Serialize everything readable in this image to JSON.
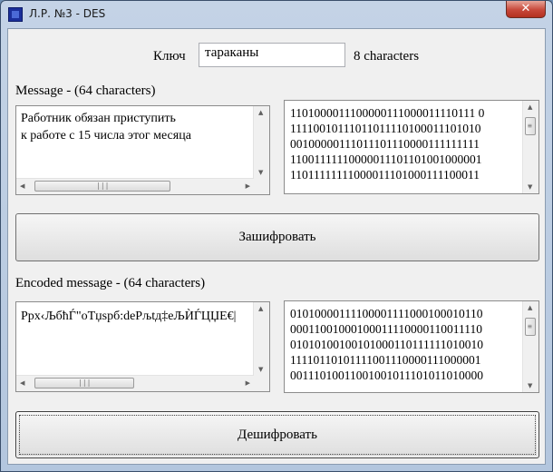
{
  "window": {
    "title": "Л.Р. №3 - DES",
    "close_glyph": "✕"
  },
  "key": {
    "label": "Ключ",
    "value": "тараканы",
    "count": "8 characters"
  },
  "message": {
    "label": "Message - (64 characters)",
    "text": "Работник обязан приступить\nк работе с 15 числа этог месяца",
    "binary": "1101000011100000111000011110111 0\n11110010111011011110100011101010\n00100000111011101110000111111111\n11001111110000011101101001000001\n11011111111000011101000111100011"
  },
  "encrypt_button": {
    "label": "Зашифровать"
  },
  "encoded": {
    "label": "Encoded message - (64 characters)",
    "text": "Ppx‹ЉбћЃ\"оТџѕрб:deРљtд‡еЉЍЃЦЏЕ€|",
    "binary": "01010000111100001111000100010110\n00011001000100011110000110011110\n01010100100101000110111111010010\n11110110101111001110000111000001\n00111010011001001011101011010000"
  },
  "decrypt_button": {
    "label": "Дешифровать"
  },
  "icons": {
    "up": "▲",
    "down": "▼",
    "left": "◀",
    "right": "▶",
    "grip_v": "≡",
    "grip_h": "|||"
  }
}
